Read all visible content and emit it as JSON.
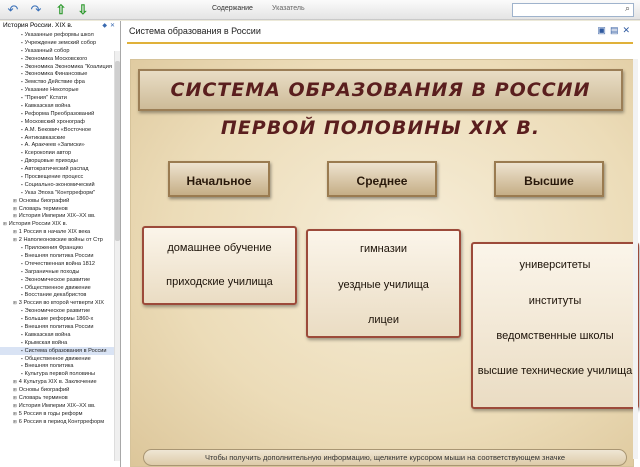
{
  "toolbar": {
    "back_glyph": "↶",
    "forward_glyph": "↷",
    "up_glyph": "⇧",
    "down_glyph": "⇩",
    "tab_contents": "Содержание",
    "tab_index": "Указатель",
    "search_value": ""
  },
  "sidebar": {
    "header": "История России. XIX в.",
    "items": [
      {
        "level": 2,
        "label": "Указанные реформы школ"
      },
      {
        "level": 2,
        "label": "Учреждение земский собор"
      },
      {
        "level": 2,
        "label": "Указанный собор"
      },
      {
        "level": 2,
        "label": "Экономика Московского"
      },
      {
        "level": 2,
        "label": "Экономика Экономика \"Коалиция"
      },
      {
        "level": 2,
        "label": "Экономика Финансовые"
      },
      {
        "level": 2,
        "label": "Земство Действие фра"
      },
      {
        "level": 2,
        "label": "Указание Некоторые"
      },
      {
        "level": 2,
        "label": "\"Прения\" Кстати"
      },
      {
        "level": 2,
        "label": "Кавказская война"
      },
      {
        "level": 2,
        "label": "Реформа Преобразований"
      },
      {
        "level": 2,
        "label": "Московский хронограф"
      },
      {
        "level": 2,
        "label": "А.М. Бекович «Восточное"
      },
      {
        "level": 2,
        "label": "Антикавказские"
      },
      {
        "level": 2,
        "label": "А. Аракчеев «Записки»"
      },
      {
        "level": 2,
        "label": "Ксерокопии автор"
      },
      {
        "level": 2,
        "label": "Дворцовые приходы"
      },
      {
        "level": 2,
        "label": "Автократический распад"
      },
      {
        "level": 2,
        "label": "Просвещение процесс"
      },
      {
        "level": 2,
        "label": "Социально-экономический"
      },
      {
        "level": 2,
        "label": "Указ Эпоха \"Контрреформ\""
      },
      {
        "level": 1,
        "label": "Основы биографий"
      },
      {
        "level": 1,
        "label": "Словарь терминов"
      },
      {
        "level": 1,
        "label": "История Империи XIX–XX вв."
      },
      {
        "level": 0,
        "label": "История России XIX в."
      },
      {
        "level": 1,
        "label": "1 Россия в начале XIX века"
      },
      {
        "level": 1,
        "label": "2 Наполеоновские войны от Стр"
      },
      {
        "level": 2,
        "label": "Приложения Францию"
      },
      {
        "level": 2,
        "label": "Внешняя политика России"
      },
      {
        "level": 2,
        "label": "Отечественная война 1812"
      },
      {
        "level": 2,
        "label": "Заграничные походы"
      },
      {
        "level": 2,
        "label": "Экономическое развитие"
      },
      {
        "level": 2,
        "label": "Общественное движение"
      },
      {
        "level": 2,
        "label": "Восстание декабристов"
      },
      {
        "level": 1,
        "label": "3 Россия во второй четверти XIX"
      },
      {
        "level": 2,
        "label": "Экономическое развитие"
      },
      {
        "level": 2,
        "label": "Большие реформы 1860-х"
      },
      {
        "level": 2,
        "label": "Внешняя политика России"
      },
      {
        "level": 2,
        "label": "Кавказская война"
      },
      {
        "level": 2,
        "label": "Крымская война"
      },
      {
        "level": 2,
        "label": "Система образования в России",
        "selected": true
      },
      {
        "level": 2,
        "label": "Общественное движение"
      },
      {
        "level": 2,
        "label": "Внешняя политика"
      },
      {
        "level": 2,
        "label": "Культура первой половины"
      },
      {
        "level": 1,
        "label": "4 Культура XIX в. Заключение"
      },
      {
        "level": 1,
        "label": "Основы биографий"
      },
      {
        "level": 1,
        "label": "Словарь терминов"
      },
      {
        "level": 1,
        "label": "История Империи XIX–XX вв."
      },
      {
        "level": 1,
        "label": "5 Россия в годы реформ"
      },
      {
        "level": 1,
        "label": "6 Россия в период Контрреформ"
      }
    ]
  },
  "content": {
    "title": "Система образования в России",
    "header_icons": [
      "save-icon",
      "print-icon",
      "close-icon"
    ]
  },
  "slide": {
    "banner": "СИСТЕМА ОБРАЗОВАНИЯ В РОССИИ ПЕРВОЙ ПОЛОВИНЫ XIX В.",
    "levels": [
      {
        "label": "Начальное",
        "items": [
          "домашнее обучение",
          "приходские училища"
        ]
      },
      {
        "label": "Среднее",
        "items": [
          "гимназии",
          "уездные училища",
          "лицеи"
        ]
      },
      {
        "label": "Высшие",
        "items": [
          "университеты",
          "институты",
          "ведомственные школы",
          "высшие технические училища"
        ]
      }
    ],
    "hint": "Чтобы получить дополнительную информацию, щелкните курсором мыши на соответствующем значке"
  }
}
